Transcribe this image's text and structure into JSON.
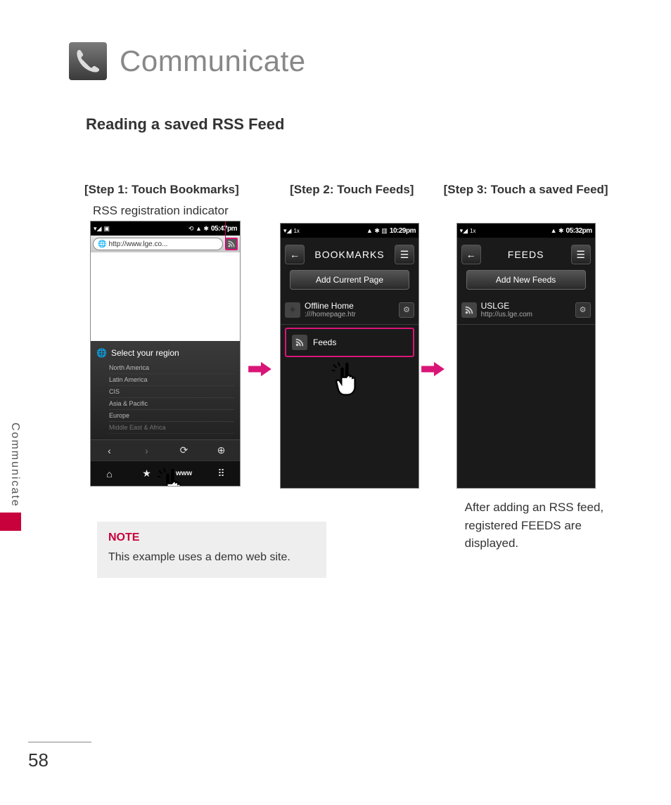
{
  "chapter": {
    "title": "Communicate"
  },
  "section": {
    "title": "Reading a saved RSS Feed"
  },
  "sidebar_label": "Communicate",
  "page_number": "58",
  "step1": {
    "title": "[Step 1: Touch Bookmarks]",
    "indicator_label": "RSS registration indicator",
    "status_time": "05:47pm",
    "url": "http://www.lge.co...",
    "region_header": "Select your region",
    "regions": [
      "North America",
      "Latin America",
      "CIS",
      "Asia & Pacific",
      "Europe",
      "Middle East & Africa"
    ],
    "bottom_www": "www"
  },
  "step2": {
    "title": "[Step 2: Touch Feeds]",
    "status_time": "10:29pm",
    "header": "BOOKMARKS",
    "action": "Add Current Page",
    "bm_title": "Offline Home",
    "bm_sub": ":///homepage.htr",
    "feeds_label": "Feeds"
  },
  "step3": {
    "title": "[Step 3: Touch a saved Feed]",
    "status_time": "05:32pm",
    "header": "FEEDS",
    "action": "Add New Feeds",
    "feed_title": "USLGE",
    "feed_sub": "http://us.lge.com",
    "after_text": "After adding an RSS feed, registered FEEDS are displayed."
  },
  "note": {
    "title": "NOTE",
    "body": "This example uses a demo web site."
  }
}
